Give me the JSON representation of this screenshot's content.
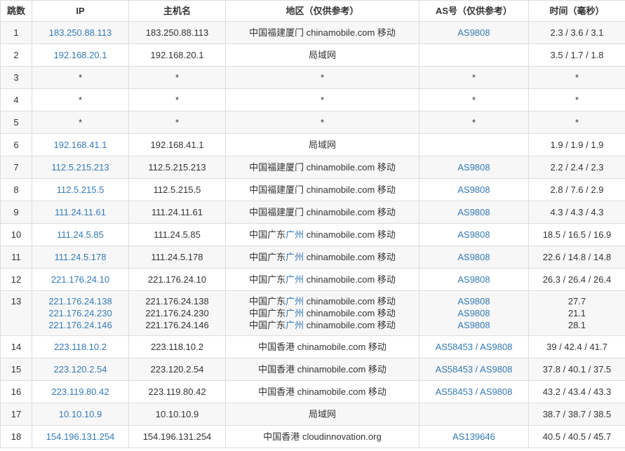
{
  "headers": [
    "跳数",
    "IP",
    "主机名",
    "地区（仅供参考）",
    "AS号（仅供参考）",
    "时间（毫秒）"
  ],
  "colors": {
    "link": "#337ab7",
    "row_alt": "#f7f7f7",
    "border": "#dddddd"
  },
  "rows": [
    {
      "hop": "1",
      "ip": [
        "183.250.88.113"
      ],
      "host": [
        "183.250.88.113"
      ],
      "region": [
        [
          "中国福建厦门",
          "",
          "chinamobile.com 移动"
        ]
      ],
      "as": [
        "AS9808"
      ],
      "time": [
        "2.3 / 3.6 / 3.1"
      ]
    },
    {
      "hop": "2",
      "ip": [
        "192.168.20.1"
      ],
      "host": [
        "192.168.20.1"
      ],
      "region": [
        [
          "局域网",
          "",
          ""
        ]
      ],
      "as": [
        ""
      ],
      "time": [
        "3.5 / 1.7 / 1.8"
      ]
    },
    {
      "hop": "3",
      "ip": [
        "*"
      ],
      "host": [
        "*"
      ],
      "region": [
        [
          "*",
          "",
          ""
        ]
      ],
      "as": [
        "*"
      ],
      "time": [
        "*"
      ]
    },
    {
      "hop": "4",
      "ip": [
        "*"
      ],
      "host": [
        "*"
      ],
      "region": [
        [
          "*",
          "",
          ""
        ]
      ],
      "as": [
        "*"
      ],
      "time": [
        "*"
      ]
    },
    {
      "hop": "5",
      "ip": [
        "*"
      ],
      "host": [
        "*"
      ],
      "region": [
        [
          "*",
          "",
          ""
        ]
      ],
      "as": [
        "*"
      ],
      "time": [
        "*"
      ]
    },
    {
      "hop": "6",
      "ip": [
        "192.168.41.1"
      ],
      "host": [
        "192.168.41.1"
      ],
      "region": [
        [
          "局域网",
          "",
          ""
        ]
      ],
      "as": [
        ""
      ],
      "time": [
        "1.9 / 1.9 / 1.9"
      ]
    },
    {
      "hop": "7",
      "ip": [
        "112.5.215.213"
      ],
      "host": [
        "112.5.215.213"
      ],
      "region": [
        [
          "中国福建厦门",
          "",
          "chinamobile.com 移动"
        ]
      ],
      "as": [
        "AS9808"
      ],
      "time": [
        "2.2 / 2.4 / 2.3"
      ]
    },
    {
      "hop": "8",
      "ip": [
        "112.5.215.5"
      ],
      "host": [
        "112.5.215.5"
      ],
      "region": [
        [
          "中国福建厦门",
          "",
          "chinamobile.com 移动"
        ]
      ],
      "as": [
        "AS9808"
      ],
      "time": [
        "2.8 / 7.6 / 2.9"
      ]
    },
    {
      "hop": "9",
      "ip": [
        "111.24.11.61"
      ],
      "host": [
        "111.24.11.61"
      ],
      "region": [
        [
          "中国福建厦门",
          "",
          "chinamobile.com 移动"
        ]
      ],
      "as": [
        "AS9808"
      ],
      "time": [
        "4.3 / 4.3 / 4.3"
      ]
    },
    {
      "hop": "10",
      "ip": [
        "111.24.5.85"
      ],
      "host": [
        "111.24.5.85"
      ],
      "region": [
        [
          "中国广东",
          "广州",
          "chinamobile.com 移动"
        ]
      ],
      "as": [
        "AS9808"
      ],
      "time": [
        "18.5 / 16.5 / 16.9"
      ]
    },
    {
      "hop": "11",
      "ip": [
        "111.24.5.178"
      ],
      "host": [
        "111.24.5.178"
      ],
      "region": [
        [
          "中国广东",
          "广州",
          "chinamobile.com 移动"
        ]
      ],
      "as": [
        "AS9808"
      ],
      "time": [
        "22.6 / 14.8 / 14.8"
      ]
    },
    {
      "hop": "12",
      "ip": [
        "221.176.24.10"
      ],
      "host": [
        "221.176.24.10"
      ],
      "region": [
        [
          "中国广东",
          "广州",
          "chinamobile.com 移动"
        ]
      ],
      "as": [
        "AS9808"
      ],
      "time": [
        "26.3 / 26.4 / 26.4"
      ]
    },
    {
      "hop": "13",
      "ip": [
        "221.176.24.138",
        "221.176.24.230",
        "221.176.24.146"
      ],
      "host": [
        "221.176.24.138",
        "221.176.24.230",
        "221.176.24.146"
      ],
      "region": [
        [
          "中国广东",
          "广州",
          "chinamobile.com 移动"
        ],
        [
          "中国广东",
          "广州",
          "chinamobile.com 移动"
        ],
        [
          "中国广东",
          "广州",
          "chinamobile.com 移动"
        ]
      ],
      "as": [
        "AS9808",
        "AS9808",
        "AS9808"
      ],
      "time": [
        "27.7",
        "21.1",
        "28.1"
      ]
    },
    {
      "hop": "14",
      "ip": [
        "223.118.10.2"
      ],
      "host": [
        "223.118.10.2"
      ],
      "region": [
        [
          "中国香港",
          "",
          "chinamobile.com 移动"
        ]
      ],
      "as": [
        "AS58453 / AS9808"
      ],
      "time": [
        "39 / 42.4 / 41.7"
      ]
    },
    {
      "hop": "15",
      "ip": [
        "223.120.2.54"
      ],
      "host": [
        "223.120.2.54"
      ],
      "region": [
        [
          "中国香港",
          "",
          "chinamobile.com 移动"
        ]
      ],
      "as": [
        "AS58453 / AS9808"
      ],
      "time": [
        "37.8 / 40.1 / 37.5"
      ]
    },
    {
      "hop": "16",
      "ip": [
        "223.119.80.42"
      ],
      "host": [
        "223.119.80.42"
      ],
      "region": [
        [
          "中国香港",
          "",
          "chinamobile.com 移动"
        ]
      ],
      "as": [
        "AS58453 / AS9808"
      ],
      "time": [
        "43.2 / 43.4 / 43.3"
      ]
    },
    {
      "hop": "17",
      "ip": [
        "10.10.10.9"
      ],
      "host": [
        "10.10.10.9"
      ],
      "region": [
        [
          "局域网",
          "",
          ""
        ]
      ],
      "as": [
        ""
      ],
      "time": [
        "38.7 / 38.7 / 38.5"
      ]
    },
    {
      "hop": "18",
      "ip": [
        "154.196.131.254"
      ],
      "host": [
        "154.196.131.254"
      ],
      "region": [
        [
          "中国香港",
          "",
          "cloudinnovation.org"
        ]
      ],
      "as": [
        "AS139646"
      ],
      "time": [
        "40.5 / 40.5 / 45.7"
      ]
    }
  ]
}
